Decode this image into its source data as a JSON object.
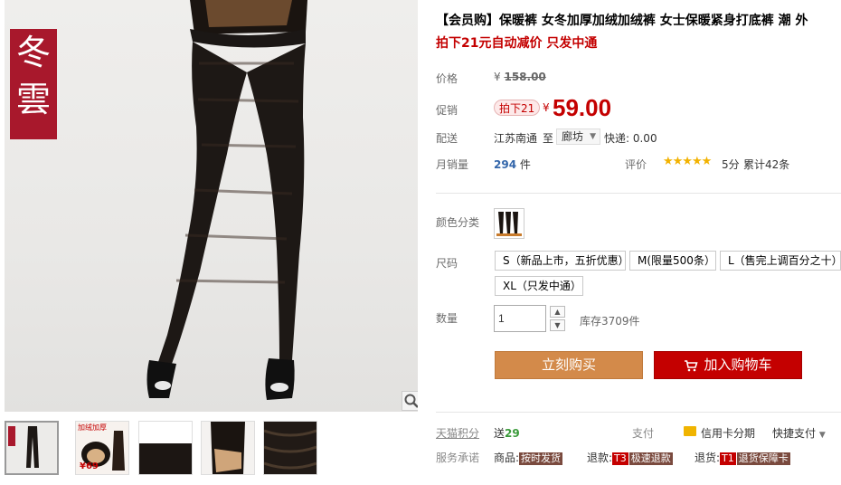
{
  "brand": {
    "logo_line1": "冬",
    "logo_line2": "雲"
  },
  "product": {
    "title": "【会员购】保暖裤 女冬加厚加绒加绒裤 女士保暖紧身打底裤 潮 外",
    "subtitle": "拍下21元自动减价 只发中通"
  },
  "price": {
    "label": "价格",
    "currency": "¥",
    "original": "158.00"
  },
  "promo": {
    "label": "促销",
    "badge": "拍下21",
    "currency": "¥",
    "price": "59.00"
  },
  "shipping": {
    "label": "配送",
    "from": "江苏南通",
    "to_word": "至",
    "destination": "廊坊",
    "fee": "快递: 0.00"
  },
  "sales": {
    "label": "月销量",
    "count": "294",
    "unit": " 件"
  },
  "rating": {
    "label": "评价",
    "stars": "★★★★★",
    "value": 5,
    "score": "5分",
    "reviews": "累计42条"
  },
  "color": {
    "label": "颜色分类"
  },
  "size": {
    "label": "尺码",
    "options": [
      "S（新品上市，五折优惠）",
      "M(限量500条）",
      "L（售完上调百分之十）",
      "XL（只发中通）"
    ]
  },
  "quantity": {
    "label": "数量",
    "value": "1",
    "up": "▲",
    "down": "▼",
    "stock": "库存3709件"
  },
  "actions": {
    "buy_now": "立刻购买",
    "add_cart": "加入购物车"
  },
  "points": {
    "label": "天猫积分",
    "prefix": "送",
    "value": "29"
  },
  "payment": {
    "label": "支付",
    "credit": "信用卡分期",
    "quick": "快捷支付"
  },
  "service": {
    "label": "服务承诺",
    "goods_prefix": "商品:",
    "goods_tag": "按时发货",
    "refund_prefix": "退款:",
    "refund_code": "T3",
    "refund_tag": "极速退款",
    "return_prefix": "退货:",
    "return_code": "T1",
    "return_tag": "退货保障卡"
  },
  "thumbnails": {
    "thumb2_text": "加绒加厚",
    "thumb2_price": "¥69"
  },
  "colors": {
    "accent_red": "#c40000",
    "buy_orange": "#d38a4a",
    "logo_red": "#a8182c",
    "star_gold": "#f2b200"
  }
}
